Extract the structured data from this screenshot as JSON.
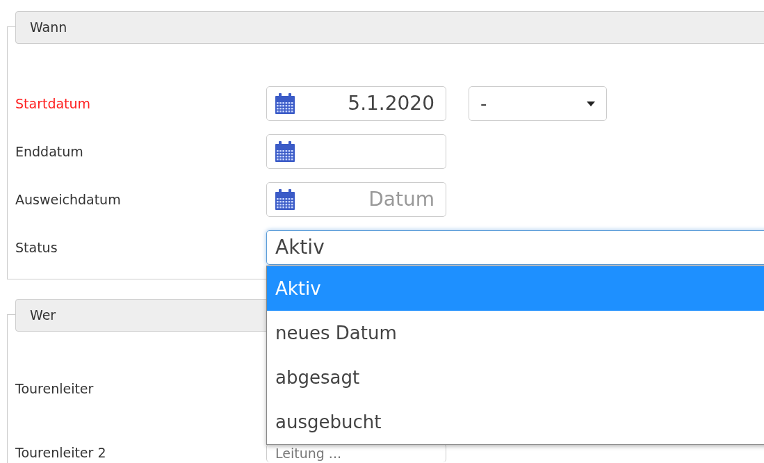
{
  "sections": [
    {
      "title": "Wann",
      "fields": [
        {
          "kind": "date",
          "label": "Startdatum",
          "required": true,
          "value": "5.1.2020",
          "time_select": {
            "value": "-"
          }
        },
        {
          "kind": "date",
          "label": "Enddatum",
          "required": false
        },
        {
          "kind": "date",
          "label": "Ausweichdatum",
          "required": false,
          "placeholder": "Datum"
        },
        {
          "kind": "select",
          "label": "Status",
          "required": false,
          "value": "Aktiv",
          "open": true,
          "options": [
            {
              "label": "Aktiv",
              "selected": true
            },
            {
              "label": "neues Datum",
              "selected": false
            },
            {
              "label": "abgesagt",
              "selected": false
            },
            {
              "label": "ausgebucht",
              "selected": false
            }
          ]
        }
      ]
    },
    {
      "title": "Wer",
      "fields": [
        {
          "kind": "label",
          "label": "Tourenleiter",
          "required": false
        },
        {
          "kind": "text",
          "label": "Tourenleiter 2",
          "required": false,
          "placeholder": "Leitung ..."
        }
      ]
    }
  ]
}
